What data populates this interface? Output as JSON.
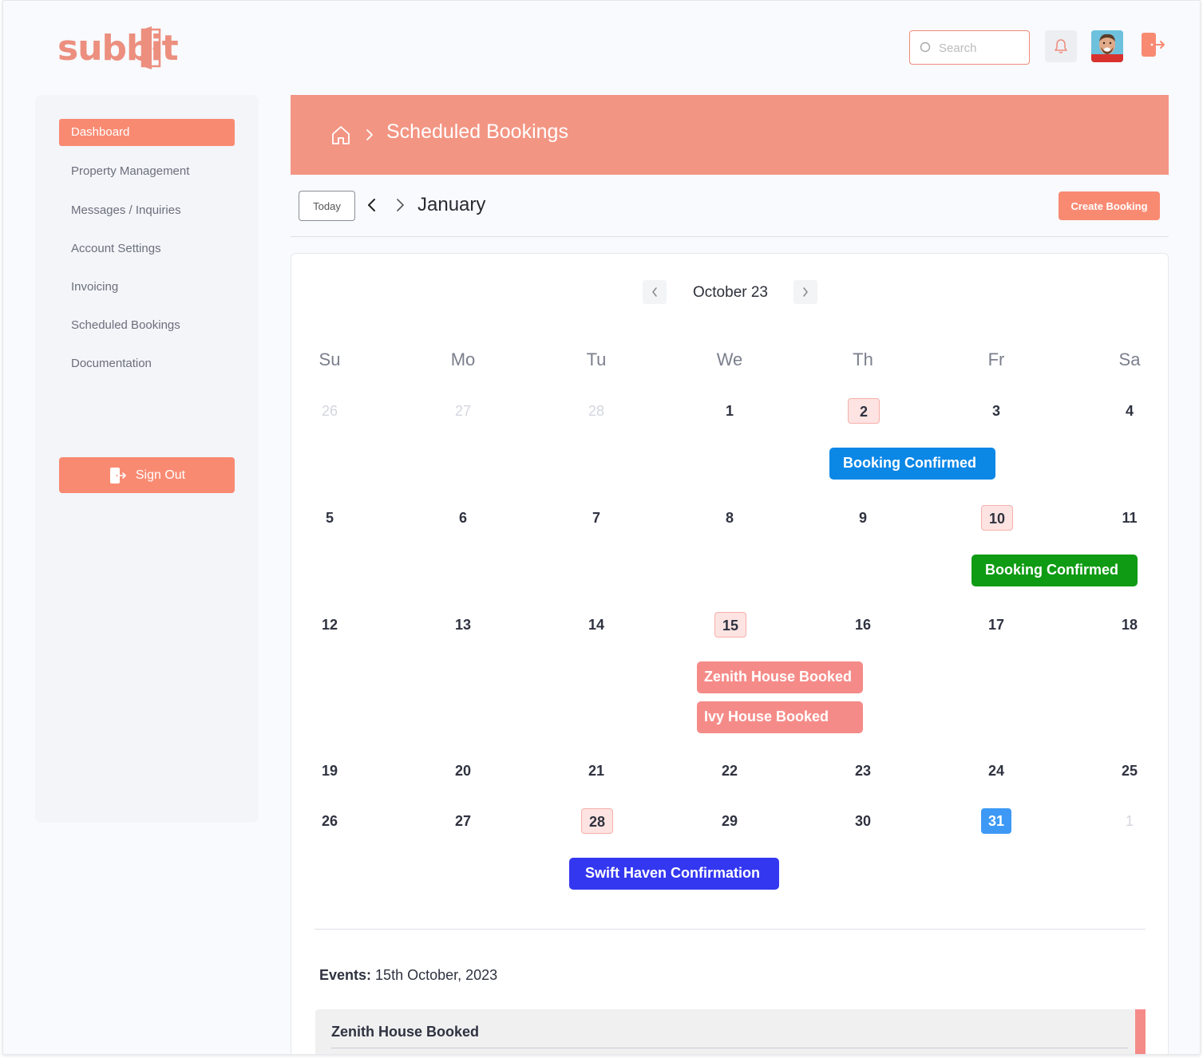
{
  "app": {
    "logo": "subbit",
    "colors": {
      "accent": "#f98a72",
      "banner": "#f39583"
    }
  },
  "header": {
    "search_placeholder": "Search",
    "icons": [
      "search-icon",
      "bell-icon",
      "avatar",
      "logout-icon"
    ]
  },
  "sidebar": {
    "items": [
      {
        "label": "Dashboard",
        "active": true
      },
      {
        "label": "Property Management",
        "active": false
      },
      {
        "label": "Messages / Inquiries",
        "active": false
      },
      {
        "label": "Account Settings",
        "active": false
      },
      {
        "label": "Invoicing",
        "active": false
      },
      {
        "label": "Scheduled Bookings",
        "active": false
      },
      {
        "label": "Documentation",
        "active": false
      }
    ],
    "signout_label": "Sign Out"
  },
  "breadcrumb": {
    "title": "Scheduled Bookings"
  },
  "toolbar": {
    "today_label": "Today",
    "month": "January",
    "create_label": "Create Booking"
  },
  "calendar": {
    "title": "October 23",
    "weekdays": [
      "Su",
      "Mo",
      "Tu",
      "We",
      "Th",
      "Fr",
      "Sa"
    ],
    "weeks": [
      [
        "26",
        "27",
        "28",
        "1",
        "2",
        "3",
        "4"
      ],
      [
        "5",
        "6",
        "7",
        "8",
        "9",
        "10",
        "11"
      ],
      [
        "12",
        "13",
        "14",
        "15",
        "16",
        "17",
        "18"
      ],
      [
        "19",
        "20",
        "21",
        "22",
        "23",
        "24",
        "25"
      ],
      [
        "26",
        "27",
        "28",
        "29",
        "30",
        "31",
        "1"
      ]
    ],
    "muted_days": [
      "0-0",
      "0-1",
      "0-2",
      "4-6"
    ],
    "highlighted_days": [
      "0-4",
      "1-5",
      "2-3",
      "4-2"
    ],
    "selected_day": "4-5",
    "events": [
      {
        "label": "Booking Confirmed",
        "color": "#0b87e6"
      },
      {
        "label": "Booking Confirmed",
        "color": "#0f9b14"
      },
      {
        "label": "Zenith House Booked",
        "color": "#f58b88"
      },
      {
        "label": "Ivy House Booked",
        "color": "#f58b88"
      },
      {
        "label": "Swift Haven Confirmation",
        "color": "#3437f0"
      }
    ]
  },
  "events_panel": {
    "heading": "Events:",
    "date": "15th October, 2023",
    "items": [
      {
        "title": "Zenith House Booked"
      }
    ]
  }
}
